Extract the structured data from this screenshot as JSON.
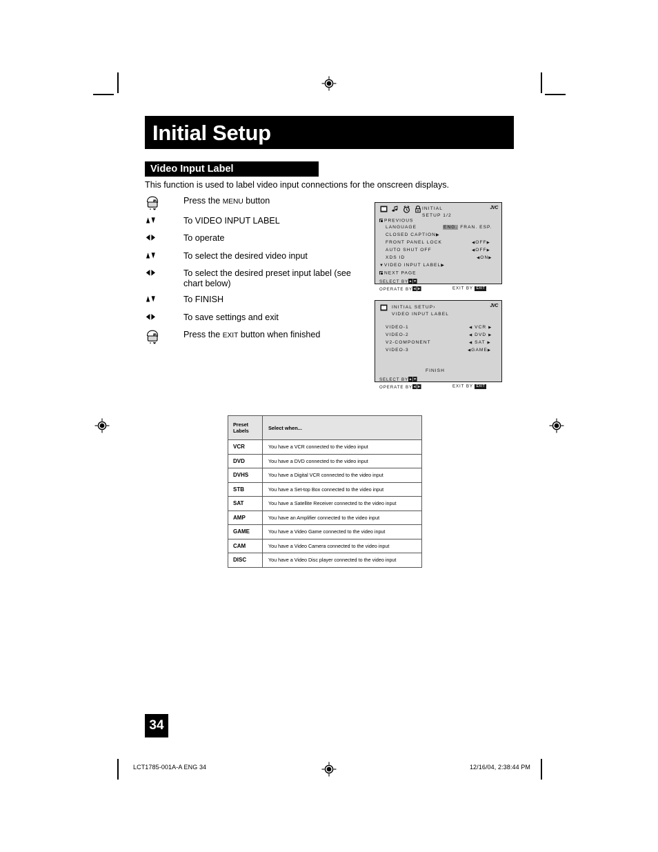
{
  "page": {
    "title": "Initial Setup",
    "section": "Video Input Label",
    "intro": "This function is used to label video input connections for the onscreen displays.",
    "number": "34"
  },
  "steps": [
    {
      "icon": "hand-press-icon",
      "text_pre": "Press the ",
      "text_caps": "Menu",
      "text_post": " button"
    },
    {
      "icon": "up-down-arrows-icon",
      "text": "To VIDEO INPUT LABEL"
    },
    {
      "icon": "left-right-arrows-icon",
      "text": "To operate"
    },
    {
      "icon": "up-down-arrows-icon",
      "text": "To select the desired video input"
    },
    {
      "icon": "left-right-arrows-icon",
      "text": "To select the desired preset input label (see chart below)"
    },
    {
      "icon": "up-down-arrows-icon",
      "text": "To FINISH"
    },
    {
      "icon": "left-right-arrows-icon",
      "text": "To save settings and exit"
    },
    {
      "icon": "hand-press-icon",
      "text_pre": "Press the ",
      "text_caps": "Exit",
      "text_post": " button when finished"
    }
  ],
  "osd1": {
    "brand": "JVC",
    "title_line1": "INITIAL",
    "title_line2": "SETUP 1/2",
    "previous": "PREVIOUS",
    "rows": [
      {
        "label": "LANGUAGE",
        "value_selected": "ENG.",
        "value_rest": "FRAN. ESP."
      },
      {
        "label": "CLOSED CAPTION",
        "value": ""
      },
      {
        "label": "FRONT PANEL LOCK",
        "value": "OFF"
      },
      {
        "label": "AUTO SHUT OFF",
        "value": "OFF"
      },
      {
        "label": "XDS ID",
        "value": "ON"
      }
    ],
    "video_input_label": "VIDEO INPUT LABEL",
    "next_page": "NEXT PAGE",
    "select_by": "SELECT   BY",
    "operate_by": "OPERATE BY",
    "exit_by": "EXIT BY",
    "exit_key": "EXIT"
  },
  "osd2": {
    "brand": "JVC",
    "title_line1": "INITIAL SETUP",
    "title_line2": "VIDEO INPUT LABEL",
    "inputs": [
      {
        "label": "VIDEO-1",
        "value": "VCR"
      },
      {
        "label": "VIDEO-2",
        "value": "DVD"
      },
      {
        "label": "V2-COMPONENT",
        "value": "SAT"
      },
      {
        "label": "VIDEO-3",
        "value": "GAME"
      }
    ],
    "finish": "FINISH",
    "select_by": "SELECT   BY",
    "operate_by": "OPERATE BY",
    "exit_by": "EXIT BY",
    "exit_key": "EXIT"
  },
  "preset_table": {
    "headers": [
      "Preset\nLabels",
      "Select when..."
    ],
    "header_col1_line1": "Preset",
    "header_col1_line2": "Labels",
    "header_col2": "Select when...",
    "rows": [
      {
        "label": "VCR",
        "desc": "You have a VCR connected to the video input"
      },
      {
        "label": "DVD",
        "desc": "You have a DVD connected to the video input"
      },
      {
        "label": "DVHS",
        "desc": "You have a Digital VCR connected to the video input"
      },
      {
        "label": "STB",
        "desc": "You have a Set-top Box connected to the video input"
      },
      {
        "label": "SAT",
        "desc": "You have a Satellite Receiver connected to the video input"
      },
      {
        "label": "AMP",
        "desc": "You have an Amplifier connected to the video input"
      },
      {
        "label": "GAME",
        "desc": "You have a Video Game connected to the video input"
      },
      {
        "label": "CAM",
        "desc": "You have a Video Camera connected to the video input"
      },
      {
        "label": "DISC",
        "desc": "You have a Video Disc player connected to the video input"
      }
    ]
  },
  "footer": {
    "left": "LCT1785-001A-A ENG   34",
    "right": "12/16/04, 2:38:44 PM"
  }
}
